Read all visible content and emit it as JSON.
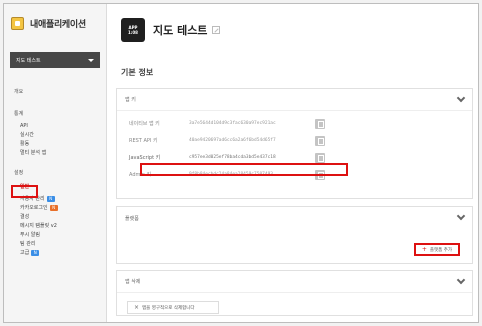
{
  "brand": {
    "title": "내애플리케이션"
  },
  "app_selector": {
    "value": "지도 테스트"
  },
  "sidebar": {
    "overview": "개요",
    "stats": {
      "title": "통계",
      "items": [
        "API",
        "실시간",
        "활동",
        "멀티 분석 앱"
      ]
    },
    "settings": {
      "title": "설정",
      "items": [
        {
          "label": "일반",
          "active": true
        },
        {
          "label": "사용자 관리",
          "badge": "blue"
        },
        {
          "label": "카카오로그인",
          "badge": "orange"
        },
        {
          "label": "결성"
        },
        {
          "label": "메시지 템플릿 v2"
        },
        {
          "label": "푸시 알림"
        },
        {
          "label": "팀 관리"
        },
        {
          "label": "고급",
          "badge": "blue"
        }
      ]
    }
  },
  "app": {
    "icon_line1": "APP",
    "icon_line2": "1:08",
    "name": "지도 테스트"
  },
  "section_title": "기본 정보",
  "app_keys": {
    "title": "앱 키",
    "rows": [
      {
        "label": "네이티브 앱 키",
        "value": "3a7e5644d104d9c3fac630a97ec921ac"
      },
      {
        "label": "REST API 키",
        "value": "40ae9420697ad6cc6a2a6f6bd54d65f7"
      },
      {
        "label": "JavaScript 키",
        "value": "c957ee3d025ef78ba4cda3bd5e437c18"
      },
      {
        "label": "Admin 키",
        "value": "9f8b84ecbdc24a84ea28459c7507493"
      }
    ]
  },
  "platform": {
    "title": "플랫폼",
    "add_button": "플랫폼 추가"
  },
  "delete_app": {
    "title": "앱 삭제",
    "button": "앱을 영구적으로 삭제합니다"
  },
  "colors": {
    "highlight": "#d11111",
    "dark": "#474747"
  }
}
